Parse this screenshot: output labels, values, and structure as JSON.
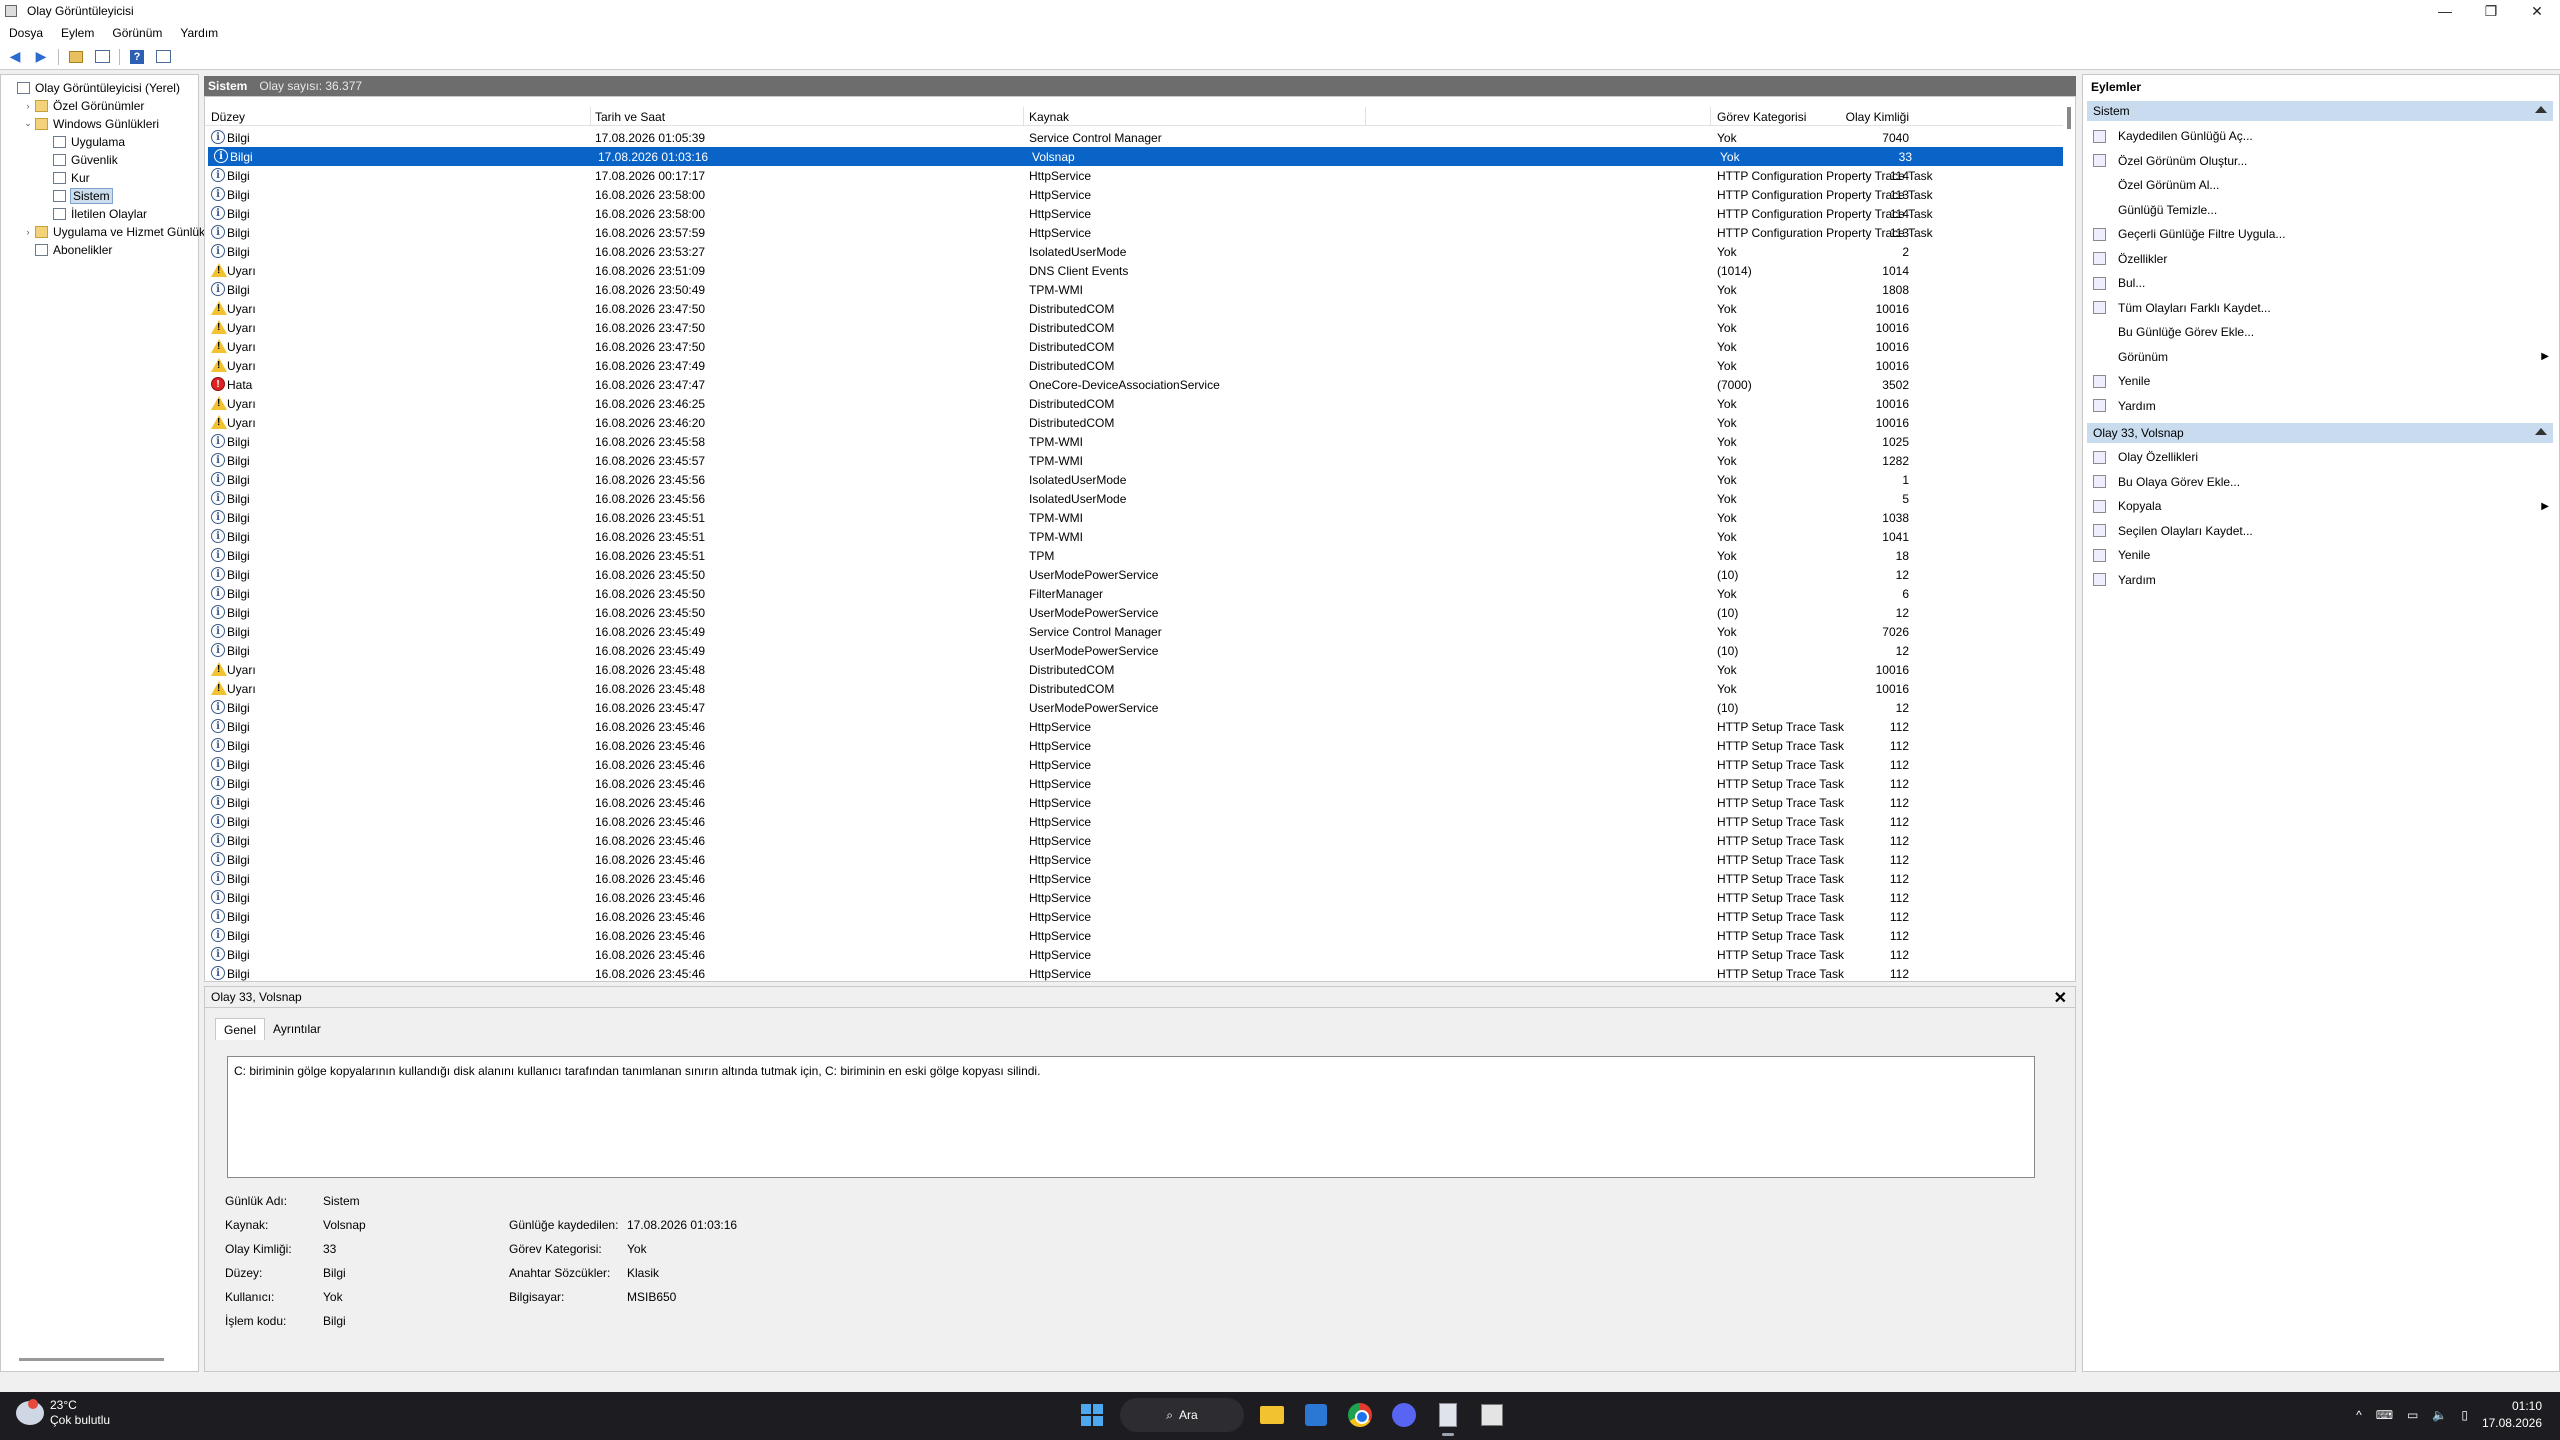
{
  "window": {
    "title": "Olay Görüntüleyicisi"
  },
  "menu": [
    "Dosya",
    "Eylem",
    "Görünüm",
    "Yardım"
  ],
  "tree": [
    {
      "label": "Olay Görüntüleyicisi (Yerel)",
      "depth": 0,
      "toggle": "",
      "icon": "app"
    },
    {
      "label": "Özel Görünümler",
      "depth": 1,
      "toggle": "›",
      "icon": "folder"
    },
    {
      "label": "Windows Günlükleri",
      "depth": 1,
      "toggle": "⌄",
      "icon": "folder"
    },
    {
      "label": "Uygulama",
      "depth": 2,
      "toggle": "",
      "icon": "log"
    },
    {
      "label": "Güvenlik",
      "depth": 2,
      "toggle": "",
      "icon": "log"
    },
    {
      "label": "Kur",
      "depth": 2,
      "toggle": "",
      "icon": "log"
    },
    {
      "label": "Sistem",
      "depth": 2,
      "toggle": "",
      "icon": "log",
      "selected": true
    },
    {
      "label": "İletilen Olaylar",
      "depth": 2,
      "toggle": "",
      "icon": "log"
    },
    {
      "label": "Uygulama ve Hizmet Günlük",
      "depth": 1,
      "toggle": "›",
      "icon": "folder"
    },
    {
      "label": "Abonelikler",
      "depth": 1,
      "toggle": "",
      "icon": "log"
    }
  ],
  "center": {
    "title": "Sistem",
    "count": "Olay sayısı: 36.377",
    "columns": {
      "level": "Düzey",
      "datetime": "Tarih ve Saat",
      "source": "Kaynak",
      "id": "Olay Kimliği",
      "category": "Görev Kategorisi"
    }
  },
  "events": [
    {
      "type": "info",
      "level": "Bilgi",
      "dt": "17.08.2026 01:05:39",
      "src": "Service Control Manager",
      "id": "7040",
      "cat": "Yok"
    },
    {
      "type": "info",
      "level": "Bilgi",
      "dt": "17.08.2026 01:03:16",
      "src": "Volsnap",
      "id": "33",
      "cat": "Yok",
      "selected": true
    },
    {
      "type": "info",
      "level": "Bilgi",
      "dt": "17.08.2026 00:17:17",
      "src": "HttpService",
      "id": "114",
      "cat": "HTTP Configuration Property Trace Task"
    },
    {
      "type": "info",
      "level": "Bilgi",
      "dt": "16.08.2026 23:58:00",
      "src": "HttpService",
      "id": "113",
      "cat": "HTTP Configuration Property Trace Task"
    },
    {
      "type": "info",
      "level": "Bilgi",
      "dt": "16.08.2026 23:58:00",
      "src": "HttpService",
      "id": "114",
      "cat": "HTTP Configuration Property Trace Task"
    },
    {
      "type": "info",
      "level": "Bilgi",
      "dt": "16.08.2026 23:57:59",
      "src": "HttpService",
      "id": "113",
      "cat": "HTTP Configuration Property Trace Task"
    },
    {
      "type": "info",
      "level": "Bilgi",
      "dt": "16.08.2026 23:53:27",
      "src": "IsolatedUserMode",
      "id": "2",
      "cat": "Yok"
    },
    {
      "type": "warn",
      "level": "Uyarı",
      "dt": "16.08.2026 23:51:09",
      "src": "DNS Client Events",
      "id": "1014",
      "cat": "(1014)"
    },
    {
      "type": "info",
      "level": "Bilgi",
      "dt": "16.08.2026 23:50:49",
      "src": "TPM-WMI",
      "id": "1808",
      "cat": "Yok"
    },
    {
      "type": "warn",
      "level": "Uyarı",
      "dt": "16.08.2026 23:47:50",
      "src": "DistributedCOM",
      "id": "10016",
      "cat": "Yok"
    },
    {
      "type": "warn",
      "level": "Uyarı",
      "dt": "16.08.2026 23:47:50",
      "src": "DistributedCOM",
      "id": "10016",
      "cat": "Yok"
    },
    {
      "type": "warn",
      "level": "Uyarı",
      "dt": "16.08.2026 23:47:50",
      "src": "DistributedCOM",
      "id": "10016",
      "cat": "Yok"
    },
    {
      "type": "warn",
      "level": "Uyarı",
      "dt": "16.08.2026 23:47:49",
      "src": "DistributedCOM",
      "id": "10016",
      "cat": "Yok"
    },
    {
      "type": "err",
      "level": "Hata",
      "dt": "16.08.2026 23:47:47",
      "src": "OneCore-DeviceAssociationService",
      "id": "3502",
      "cat": "(7000)"
    },
    {
      "type": "warn",
      "level": "Uyarı",
      "dt": "16.08.2026 23:46:25",
      "src": "DistributedCOM",
      "id": "10016",
      "cat": "Yok"
    },
    {
      "type": "warn",
      "level": "Uyarı",
      "dt": "16.08.2026 23:46:20",
      "src": "DistributedCOM",
      "id": "10016",
      "cat": "Yok"
    },
    {
      "type": "info",
      "level": "Bilgi",
      "dt": "16.08.2026 23:45:58",
      "src": "TPM-WMI",
      "id": "1025",
      "cat": "Yok"
    },
    {
      "type": "info",
      "level": "Bilgi",
      "dt": "16.08.2026 23:45:57",
      "src": "TPM-WMI",
      "id": "1282",
      "cat": "Yok"
    },
    {
      "type": "info",
      "level": "Bilgi",
      "dt": "16.08.2026 23:45:56",
      "src": "IsolatedUserMode",
      "id": "1",
      "cat": "Yok"
    },
    {
      "type": "info",
      "level": "Bilgi",
      "dt": "16.08.2026 23:45:56",
      "src": "IsolatedUserMode",
      "id": "5",
      "cat": "Yok"
    },
    {
      "type": "info",
      "level": "Bilgi",
      "dt": "16.08.2026 23:45:51",
      "src": "TPM-WMI",
      "id": "1038",
      "cat": "Yok"
    },
    {
      "type": "info",
      "level": "Bilgi",
      "dt": "16.08.2026 23:45:51",
      "src": "TPM-WMI",
      "id": "1041",
      "cat": "Yok"
    },
    {
      "type": "info",
      "level": "Bilgi",
      "dt": "16.08.2026 23:45:51",
      "src": "TPM",
      "id": "18",
      "cat": "Yok"
    },
    {
      "type": "info",
      "level": "Bilgi",
      "dt": "16.08.2026 23:45:50",
      "src": "UserModePowerService",
      "id": "12",
      "cat": "(10)"
    },
    {
      "type": "info",
      "level": "Bilgi",
      "dt": "16.08.2026 23:45:50",
      "src": "FilterManager",
      "id": "6",
      "cat": "Yok"
    },
    {
      "type": "info",
      "level": "Bilgi",
      "dt": "16.08.2026 23:45:50",
      "src": "UserModePowerService",
      "id": "12",
      "cat": "(10)"
    },
    {
      "type": "info",
      "level": "Bilgi",
      "dt": "16.08.2026 23:45:49",
      "src": "Service Control Manager",
      "id": "7026",
      "cat": "Yok"
    },
    {
      "type": "info",
      "level": "Bilgi",
      "dt": "16.08.2026 23:45:49",
      "src": "UserModePowerService",
      "id": "12",
      "cat": "(10)"
    },
    {
      "type": "warn",
      "level": "Uyarı",
      "dt": "16.08.2026 23:45:48",
      "src": "DistributedCOM",
      "id": "10016",
      "cat": "Yok"
    },
    {
      "type": "warn",
      "level": "Uyarı",
      "dt": "16.08.2026 23:45:48",
      "src": "DistributedCOM",
      "id": "10016",
      "cat": "Yok"
    },
    {
      "type": "info",
      "level": "Bilgi",
      "dt": "16.08.2026 23:45:47",
      "src": "UserModePowerService",
      "id": "12",
      "cat": "(10)"
    },
    {
      "type": "info",
      "level": "Bilgi",
      "dt": "16.08.2026 23:45:46",
      "src": "HttpService",
      "id": "112",
      "cat": "HTTP Setup Trace Task"
    },
    {
      "type": "info",
      "level": "Bilgi",
      "dt": "16.08.2026 23:45:46",
      "src": "HttpService",
      "id": "112",
      "cat": "HTTP Setup Trace Task"
    },
    {
      "type": "info",
      "level": "Bilgi",
      "dt": "16.08.2026 23:45:46",
      "src": "HttpService",
      "id": "112",
      "cat": "HTTP Setup Trace Task"
    },
    {
      "type": "info",
      "level": "Bilgi",
      "dt": "16.08.2026 23:45:46",
      "src": "HttpService",
      "id": "112",
      "cat": "HTTP Setup Trace Task"
    },
    {
      "type": "info",
      "level": "Bilgi",
      "dt": "16.08.2026 23:45:46",
      "src": "HttpService",
      "id": "112",
      "cat": "HTTP Setup Trace Task"
    },
    {
      "type": "info",
      "level": "Bilgi",
      "dt": "16.08.2026 23:45:46",
      "src": "HttpService",
      "id": "112",
      "cat": "HTTP Setup Trace Task"
    },
    {
      "type": "info",
      "level": "Bilgi",
      "dt": "16.08.2026 23:45:46",
      "src": "HttpService",
      "id": "112",
      "cat": "HTTP Setup Trace Task"
    },
    {
      "type": "info",
      "level": "Bilgi",
      "dt": "16.08.2026 23:45:46",
      "src": "HttpService",
      "id": "112",
      "cat": "HTTP Setup Trace Task"
    },
    {
      "type": "info",
      "level": "Bilgi",
      "dt": "16.08.2026 23:45:46",
      "src": "HttpService",
      "id": "112",
      "cat": "HTTP Setup Trace Task"
    },
    {
      "type": "info",
      "level": "Bilgi",
      "dt": "16.08.2026 23:45:46",
      "src": "HttpService",
      "id": "112",
      "cat": "HTTP Setup Trace Task"
    },
    {
      "type": "info",
      "level": "Bilgi",
      "dt": "16.08.2026 23:45:46",
      "src": "HttpService",
      "id": "112",
      "cat": "HTTP Setup Trace Task"
    },
    {
      "type": "info",
      "level": "Bilgi",
      "dt": "16.08.2026 23:45:46",
      "src": "HttpService",
      "id": "112",
      "cat": "HTTP Setup Trace Task"
    },
    {
      "type": "info",
      "level": "Bilgi",
      "dt": "16.08.2026 23:45:46",
      "src": "HttpService",
      "id": "112",
      "cat": "HTTP Setup Trace Task"
    },
    {
      "type": "info",
      "level": "Bilgi",
      "dt": "16.08.2026 23:45:46",
      "src": "HttpService",
      "id": "112",
      "cat": "HTTP Setup Trace Task"
    }
  ],
  "detail": {
    "title": "Olay 33, Volsnap",
    "close": "✕",
    "tabs": [
      "Genel",
      "Ayrıntılar"
    ],
    "message": "C: biriminin gölge kopyalarının kullandığı disk alanını kullanıcı tarafından tanımlanan sınırın altında tutmak için, C: biriminin en eski gölge kopyası silindi.",
    "labels": {
      "log_name": "Günlük Adı:",
      "source": "Kaynak:",
      "event_id": "Olay Kimliği:",
      "level": "Düzey:",
      "user": "Kullanıcı:",
      "opcode": "İşlem kodu:",
      "logged": "Günlüğe kaydedilen:",
      "task_category": "Görev Kategorisi:",
      "keywords": "Anahtar Sözcükler:",
      "computer": "Bilgisayar:"
    },
    "values": {
      "log_name": "Sistem",
      "source": "Volsnap",
      "event_id": "33",
      "level": "Bilgi",
      "user": "Yok",
      "opcode": "Bilgi",
      "logged": "17.08.2026 01:03:16",
      "task_category": "Yok",
      "keywords": "Klasik",
      "computer": "MSIB650"
    }
  },
  "actions": {
    "header": "Eylemler",
    "section1": {
      "title": "Sistem",
      "items": [
        {
          "label": "Kaydedilen Günlüğü Aç...",
          "icon": "open-log-icon"
        },
        {
          "label": "Özel Görünüm Oluştur...",
          "icon": "filter-icon"
        },
        {
          "label": "Özel Görünüm Al...",
          "icon": ""
        },
        {
          "label": "Günlüğü Temizle...",
          "icon": ""
        },
        {
          "label": "Geçerli Günlüğe Filtre Uygula...",
          "icon": "filter-icon"
        },
        {
          "label": "Özellikler",
          "icon": "properties-icon"
        },
        {
          "label": "Bul...",
          "icon": "find-icon"
        },
        {
          "label": "Tüm Olayları Farklı Kaydet...",
          "icon": "save-icon"
        },
        {
          "label": "Bu Günlüğe Görev Ekle...",
          "icon": ""
        },
        {
          "label": "Görünüm",
          "icon": "",
          "submenu": true
        },
        {
          "label": "Yenile",
          "icon": "refresh-icon"
        },
        {
          "label": "Yardım",
          "icon": "help-icon"
        }
      ]
    },
    "section2": {
      "title": "Olay 33, Volsnap",
      "items": [
        {
          "label": "Olay Özellikleri",
          "icon": "properties-icon"
        },
        {
          "label": "Bu Olaya Görev Ekle...",
          "icon": "task-icon"
        },
        {
          "label": "Kopyala",
          "icon": "copy-icon",
          "submenu": true
        },
        {
          "label": "Seçilen Olayları Kaydet...",
          "icon": "save-icon"
        },
        {
          "label": "Yenile",
          "icon": "refresh-icon"
        },
        {
          "label": "Yardım",
          "icon": "help-icon"
        }
      ]
    }
  },
  "taskbar": {
    "temperature": "23°C",
    "weather": "Çok bulutlu",
    "search": "Ara",
    "time": "01:10",
    "date": "17.08.2026"
  }
}
